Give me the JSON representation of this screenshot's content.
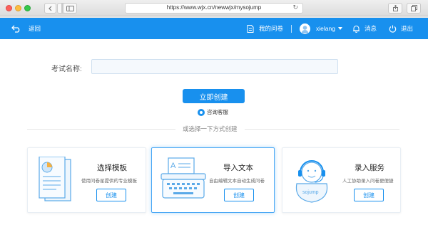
{
  "browser": {
    "url": "https://www.wjx.cn/newwjx/mysojump",
    "back_icon": "chevron-left-icon",
    "forward_icon": "chevron-right-icon",
    "sidebar_icon": "sidebar-icon",
    "reload_icon": "reload-icon",
    "share_icon": "share-icon",
    "tabs_icon": "tabs-icon"
  },
  "header": {
    "back_label": "返回",
    "my_surveys_label": "我的问卷",
    "username": "xielang",
    "messages_label": "消息",
    "logout_label": "退出",
    "bg_color": "#1890ee"
  },
  "form": {
    "exam_name_label": "考试名称:",
    "exam_name_value": "",
    "create_now_label": "立即创建",
    "consult_label": "咨询客服"
  },
  "divider_text": "或选择一下方式创建",
  "cards": [
    {
      "title": "选择模板",
      "desc": "使用问卷星提供的专业模板",
      "button": "创建",
      "icon": "template-docs-icon"
    },
    {
      "title": "导入文本",
      "desc": "自由编辑文本自动生成问卷",
      "button": "创建",
      "icon": "typewriter-icon",
      "active": true
    },
    {
      "title": "录入服务",
      "desc": "人工协助录入问卷更便捷",
      "button": "创建",
      "icon": "customer-service-icon",
      "illustration_text": "sojump"
    }
  ]
}
